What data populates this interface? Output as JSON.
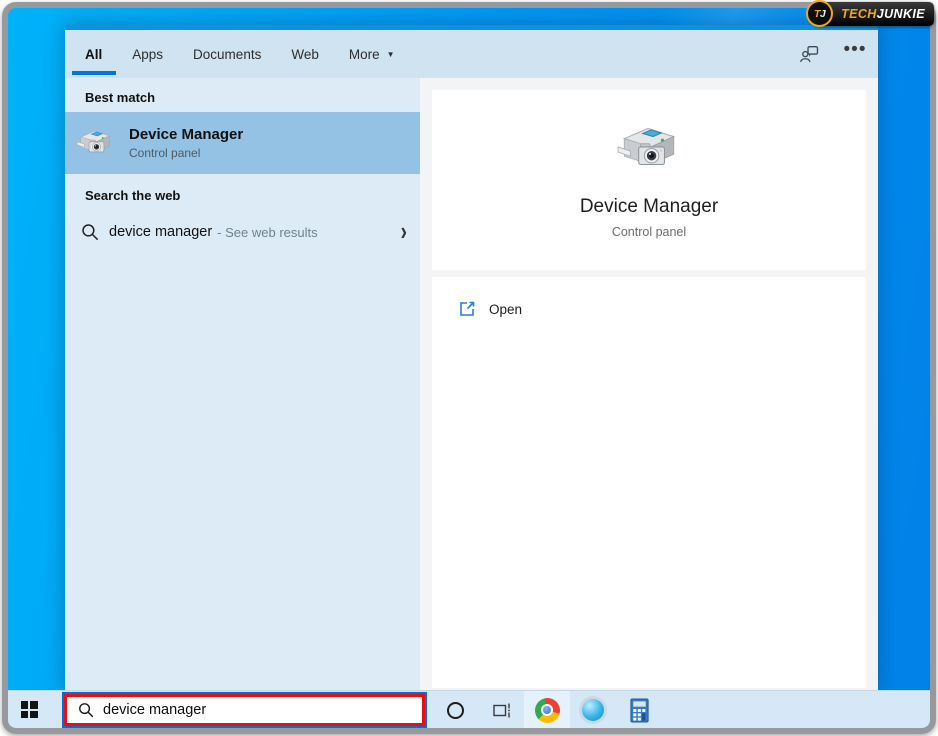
{
  "branding": {
    "badge_t": "T",
    "badge_j": "J",
    "name_part1": "TECH",
    "name_part2": "JUNKIE"
  },
  "search_panel": {
    "tabs": [
      {
        "label": "All",
        "selected": true
      },
      {
        "label": "Apps",
        "selected": false
      },
      {
        "label": "Documents",
        "selected": false
      },
      {
        "label": "Web",
        "selected": false
      },
      {
        "label": "More",
        "selected": false,
        "dropdown": true
      }
    ],
    "left": {
      "best_match_header": "Best match",
      "best_match": {
        "title": "Device Manager",
        "subtitle": "Control panel",
        "icon": "device-manager-icon"
      },
      "web_header": "Search the web",
      "web_row": {
        "query": "device manager",
        "suffix": "- See web results",
        "icon": "search-icon",
        "chevron": "chevron-right-icon"
      }
    },
    "detail": {
      "title": "Device Manager",
      "subtitle": "Control panel",
      "icon": "device-manager-icon",
      "actions": [
        {
          "label": "Open",
          "icon": "open-external-icon"
        }
      ]
    },
    "header_icons": [
      "feedback-icon",
      "more-options-icon"
    ]
  },
  "taskbar": {
    "search_value": "device manager",
    "icons": [
      "windows-start-icon",
      "search-icon",
      "cortana-circle-icon",
      "task-view-icon",
      "chrome-icon",
      "blue-sphere-app-icon",
      "calculator-icon"
    ]
  },
  "glyphs": {
    "dropdown_arrow": "▼",
    "ellipsis": "•••",
    "chevron_right": "›"
  },
  "colors": {
    "accent_blue": "#0077d4",
    "desktop_blue": "#0098f3",
    "panel_bg": "#dcebf6",
    "tabbar_bg": "#cfe3f0",
    "selected_row": "#93c2e4",
    "taskbar_bg": "#d5e8f5",
    "annotation_red": "#e8100e",
    "open_icon_blue": "#2b7cd3",
    "logo_yellow": "#f2a71b"
  }
}
